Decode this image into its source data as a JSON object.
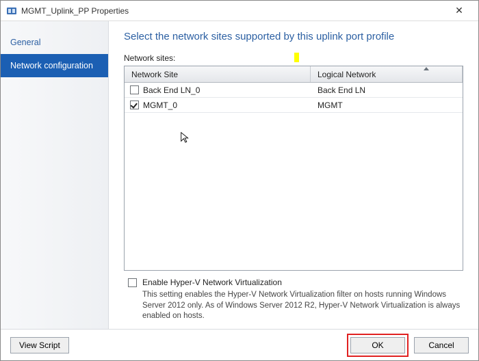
{
  "window": {
    "title": "MGMT_Uplink_PP Properties"
  },
  "sidebar": {
    "items": [
      {
        "label": "General"
      },
      {
        "label": "Network configuration"
      }
    ],
    "activeIndex": 1
  },
  "main": {
    "heading": "Select the network sites supported by this uplink port profile",
    "sitesLabel": "Network sites:",
    "columns": {
      "site": "Network Site",
      "logical": "Logical Network"
    },
    "rows": [
      {
        "checked": false,
        "site": "Back End LN_0",
        "logical": "Back End LN"
      },
      {
        "checked": true,
        "site": "MGMT_0",
        "logical": "MGMT"
      }
    ],
    "enableHvLabel": "Enable Hyper-V Network Virtualization",
    "enableHvChecked": false,
    "enableHvDesc": "This setting enables the Hyper-V Network Virtualization filter on hosts running Windows Server 2012 only. As of Windows Server 2012 R2, Hyper-V Network Virtualization is always enabled on hosts."
  },
  "footer": {
    "viewScript": "View Script",
    "ok": "OK",
    "cancel": "Cancel"
  }
}
